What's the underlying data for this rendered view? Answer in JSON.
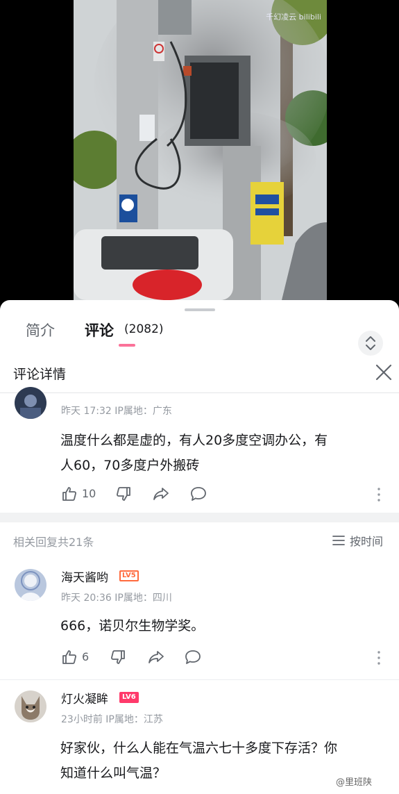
{
  "video": {
    "watermark": "千幻凌云 bilibili"
  },
  "tabs": {
    "intro": "简介",
    "comment": "评论",
    "count": "(2082)"
  },
  "detail": {
    "title": "评论详情"
  },
  "main_comment": {
    "meta": "昨天 17:32 IP属地：广东",
    "text_line1": "温度什么都是虚的，有人20多度空调办公，有",
    "text_line2": "人60，70多度户外搬砖",
    "likes": "10"
  },
  "replies_header": {
    "count": "相关回复共21条",
    "sort": "按时间"
  },
  "replies": [
    {
      "name": "海天酱哟",
      "level": "LV5",
      "meta": "昨天 20:36 IP属地：四川",
      "text_line1": "666，诺贝尔生物学奖。",
      "likes": "6"
    },
    {
      "name": "灯火凝眸",
      "level": "LV6",
      "meta": "23小时前 IP属地：江苏",
      "text_line1": "好家伙，什么人能在气温六七十多度下存活？你",
      "text_line2": "知道什么叫气温？"
    }
  ],
  "weibo_watermark": "@里班陕",
  "colors": {
    "accent": "#fb7299",
    "level": "#ff6a3d",
    "muted": "#9499a0"
  }
}
